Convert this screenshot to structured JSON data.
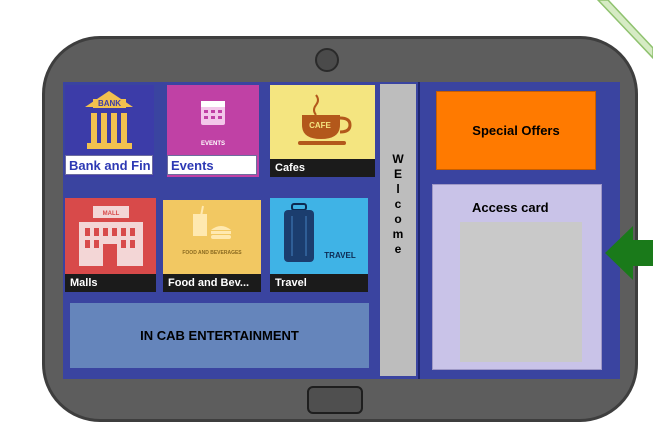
{
  "screen": {
    "tiles": [
      {
        "label": "Bank and Fin",
        "badge": "BANK",
        "color": "#3c3ca8",
        "style": "white"
      },
      {
        "label": "Events",
        "badge": "EVENTS",
        "color": "#c041a5",
        "style": "white"
      },
      {
        "label": "Cafes",
        "badge": "CAFE",
        "color": "#f4e580",
        "style": "dark"
      },
      {
        "label": "Malls",
        "badge": "MALL",
        "color": "#d84a4a",
        "style": "dark"
      },
      {
        "label": "Food and Bev...",
        "badge": "FOOD AND BEVERAGES",
        "color": "#f2c862",
        "style": "dark"
      },
      {
        "label": "Travel",
        "badge": "TRAVEL",
        "color": "#3fb3e6",
        "style": "dark"
      }
    ],
    "welcome_letters": [
      "W",
      "E",
      "l",
      "c",
      "o",
      "m",
      "e"
    ],
    "entertainment_label": "IN CAB ENTERTAINMENT",
    "offers_label": "Special Offers",
    "access_card_label": "Access card"
  },
  "colors": {
    "screen_bg": "#3a44a0",
    "tablet_body": "#5d5d5d",
    "offers": "#ff7a00",
    "access_panel": "#c9c3e8",
    "arrow": "#1a7a1a"
  }
}
